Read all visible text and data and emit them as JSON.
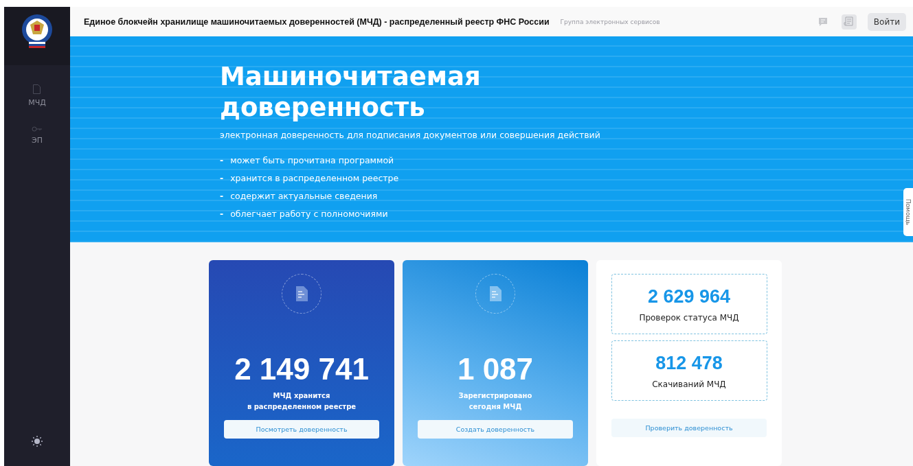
{
  "header": {
    "title": "Единое блокчейн хранилище машиночитаемых доверенностей (МЧД) - распределенный реестр ФНС России",
    "subtitle": "Группа электронных сервисов",
    "login_button": "Войти"
  },
  "sidebar": {
    "items": [
      {
        "label": "МЧД",
        "kind": "document"
      },
      {
        "label": "ЭП",
        "kind": "key"
      }
    ]
  },
  "hero": {
    "title": "Машиночитаемая доверенность",
    "subtitle": "электронная доверенность для подписания документов или совершения действий",
    "bullet_mark": "-",
    "bullets": [
      "может быть прочитана программой",
      "хранится в распределенном реестре",
      "содержит актуальные сведения",
      "облегчает работу с полномочиями"
    ]
  },
  "help_tab": "Помощь",
  "cards": [
    {
      "kind": "dark",
      "number": "2 149 741",
      "label_lines": [
        "МЧД хранится",
        "в распределенном реестре"
      ],
      "button": "Посмотреть доверенность"
    },
    {
      "kind": "light",
      "number": "1 087",
      "label_lines": [
        "Зарегистрировано",
        "сегодня МЧД"
      ],
      "button": "Создать доверенность"
    }
  ],
  "stats_card": {
    "stats": [
      {
        "number": "2 629 964",
        "label": "Проверок статуса МЧД"
      },
      {
        "number": "812 478",
        "label": "Скачиваний МЧД"
      }
    ],
    "button": "Проверить доверенность"
  }
}
